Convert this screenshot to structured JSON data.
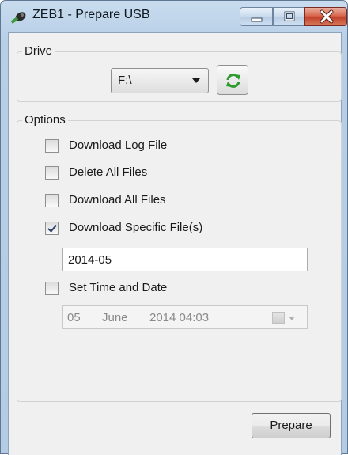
{
  "window": {
    "title": "ZEB1 - Prepare USB",
    "icons": {
      "app": "zeb-app-icon",
      "minimize": "minimize-icon",
      "maximize": "maximize-icon",
      "close": "close-icon"
    }
  },
  "drive": {
    "legend": "Drive",
    "selected": "F:\\",
    "refresh_icon": "refresh-icon"
  },
  "options": {
    "legend": "Options",
    "items": [
      {
        "label": "Download Log File",
        "checked": false
      },
      {
        "label": "Delete All Files",
        "checked": false
      },
      {
        "label": "Download All Files",
        "checked": false
      },
      {
        "label": "Download Specific File(s)",
        "checked": true
      }
    ],
    "specific_files_value": "2014-05",
    "set_time": {
      "label": "Set Time and Date",
      "checked": false
    },
    "datetime": {
      "day": "05",
      "month": "June",
      "rest": "2014 04:03"
    }
  },
  "footer": {
    "prepare_label": "Prepare"
  },
  "colors": {
    "accent_green": "#2f9a2f",
    "close_red": "#c2422a",
    "title_blue": "#b8cfe6"
  }
}
